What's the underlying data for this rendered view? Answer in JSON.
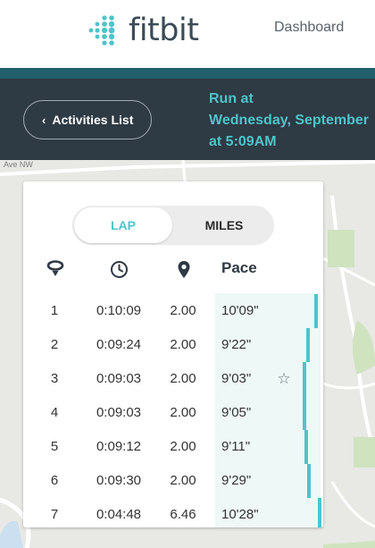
{
  "header": {
    "brand": "fitbit",
    "nav_link": "Dashboard"
  },
  "titlebar": {
    "back_label": "Activities List",
    "title_line1": "Run at",
    "title_line2": "Wednesday, September",
    "title_line3": "at 5:09AM"
  },
  "map": {
    "street_label": "Ave NW"
  },
  "toggle": {
    "lap": "LAP",
    "miles": "MILES",
    "selected": "LAP"
  },
  "table": {
    "icons": [
      "lap-icon",
      "clock-icon",
      "location-pin-icon"
    ],
    "pace_header": "Pace",
    "rows": [
      {
        "lap": "1",
        "time": "0:10:09",
        "dist": "2.00",
        "pace": "10'09\"",
        "pace_seconds": 609,
        "fastest": false
      },
      {
        "lap": "2",
        "time": "0:09:24",
        "dist": "2.00",
        "pace": "9'22\"",
        "pace_seconds": 562,
        "fastest": false
      },
      {
        "lap": "3",
        "time": "0:09:03",
        "dist": "2.00",
        "pace": "9'03\"",
        "pace_seconds": 543,
        "fastest": true
      },
      {
        "lap": "4",
        "time": "0:09:03",
        "dist": "2.00",
        "pace": "9'05\"",
        "pace_seconds": 545,
        "fastest": false
      },
      {
        "lap": "5",
        "time": "0:09:12",
        "dist": "2.00",
        "pace": "9'11\"",
        "pace_seconds": 551,
        "fastest": false
      },
      {
        "lap": "6",
        "time": "0:09:30",
        "dist": "2.00",
        "pace": "9'29\"",
        "pace_seconds": 569,
        "fastest": false
      },
      {
        "lap": "7",
        "time": "0:04:48",
        "dist": "6.46",
        "pace": "10'28\"",
        "pace_seconds": 628,
        "fastest": false
      }
    ]
  },
  "colors": {
    "accent": "#4ec4c9",
    "dark": "#2e3a44",
    "band": "#215f6b",
    "pace_bg": "#eef8f6"
  }
}
